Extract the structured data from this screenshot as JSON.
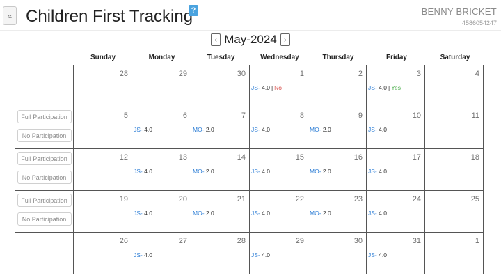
{
  "header": {
    "back_label": "«",
    "title": "Children First Tracking",
    "help_label": "?",
    "user_name": "BENNY BRICKET",
    "user_id": "4586054247"
  },
  "nav": {
    "prev_label": "‹",
    "month_label": "May-2024",
    "next_label": "›"
  },
  "days_of_week": [
    "Sunday",
    "Monday",
    "Tuesday",
    "Wednesday",
    "Thursday",
    "Friday",
    "Saturday"
  ],
  "controls": {
    "full_label": "Full Participation",
    "no_label": "No Participation"
  },
  "weeks": [
    {
      "has_controls": false,
      "days": [
        {
          "num": "28"
        },
        {
          "num": "29"
        },
        {
          "num": "30"
        },
        {
          "num": "1",
          "code": "JS-",
          "val": "4.0",
          "sep": "|",
          "status": "No",
          "status_type": "no"
        },
        {
          "num": "2"
        },
        {
          "num": "3",
          "code": "JS-",
          "val": "4.0",
          "sep": "|",
          "status": "Yes",
          "status_type": "yes"
        },
        {
          "num": "4"
        }
      ]
    },
    {
      "has_controls": true,
      "days": [
        {
          "num": "5"
        },
        {
          "num": "6",
          "code": "JS-",
          "val": "4.0"
        },
        {
          "num": "7",
          "code": "MO-",
          "val": "2.0"
        },
        {
          "num": "8",
          "code": "JS-",
          "val": "4.0"
        },
        {
          "num": "9",
          "code": "MO-",
          "val": "2.0"
        },
        {
          "num": "10",
          "code": "JS-",
          "val": "4.0"
        },
        {
          "num": "11"
        }
      ]
    },
    {
      "has_controls": true,
      "days": [
        {
          "num": "12"
        },
        {
          "num": "13",
          "code": "JS-",
          "val": "4.0"
        },
        {
          "num": "14",
          "code": "MO-",
          "val": "2.0"
        },
        {
          "num": "15",
          "code": "JS-",
          "val": "4.0"
        },
        {
          "num": "16",
          "code": "MO-",
          "val": "2.0"
        },
        {
          "num": "17",
          "code": "JS-",
          "val": "4.0"
        },
        {
          "num": "18"
        }
      ]
    },
    {
      "has_controls": true,
      "days": [
        {
          "num": "19"
        },
        {
          "num": "20",
          "code": "JS-",
          "val": "4.0"
        },
        {
          "num": "21",
          "code": "MO-",
          "val": "2.0"
        },
        {
          "num": "22",
          "code": "JS-",
          "val": "4.0"
        },
        {
          "num": "23",
          "code": "MO-",
          "val": "2.0"
        },
        {
          "num": "24",
          "code": "JS-",
          "val": "4.0"
        },
        {
          "num": "25"
        }
      ]
    },
    {
      "has_controls": false,
      "days": [
        {
          "num": "26"
        },
        {
          "num": "27",
          "code": "JS-",
          "val": "4.0"
        },
        {
          "num": "28"
        },
        {
          "num": "29",
          "code": "JS-",
          "val": "4.0"
        },
        {
          "num": "30"
        },
        {
          "num": "31",
          "code": "JS-",
          "val": "4.0"
        },
        {
          "num": "1"
        }
      ]
    }
  ],
  "colors": {
    "code": "#2f7fd6",
    "no": "#d9534f",
    "yes": "#4cae4c",
    "help": "#4aa3df"
  },
  "icons": {
    "back": "double-chevron-left-icon",
    "help": "question-mark-icon",
    "prev": "chevron-left-icon",
    "next": "chevron-right-icon"
  }
}
